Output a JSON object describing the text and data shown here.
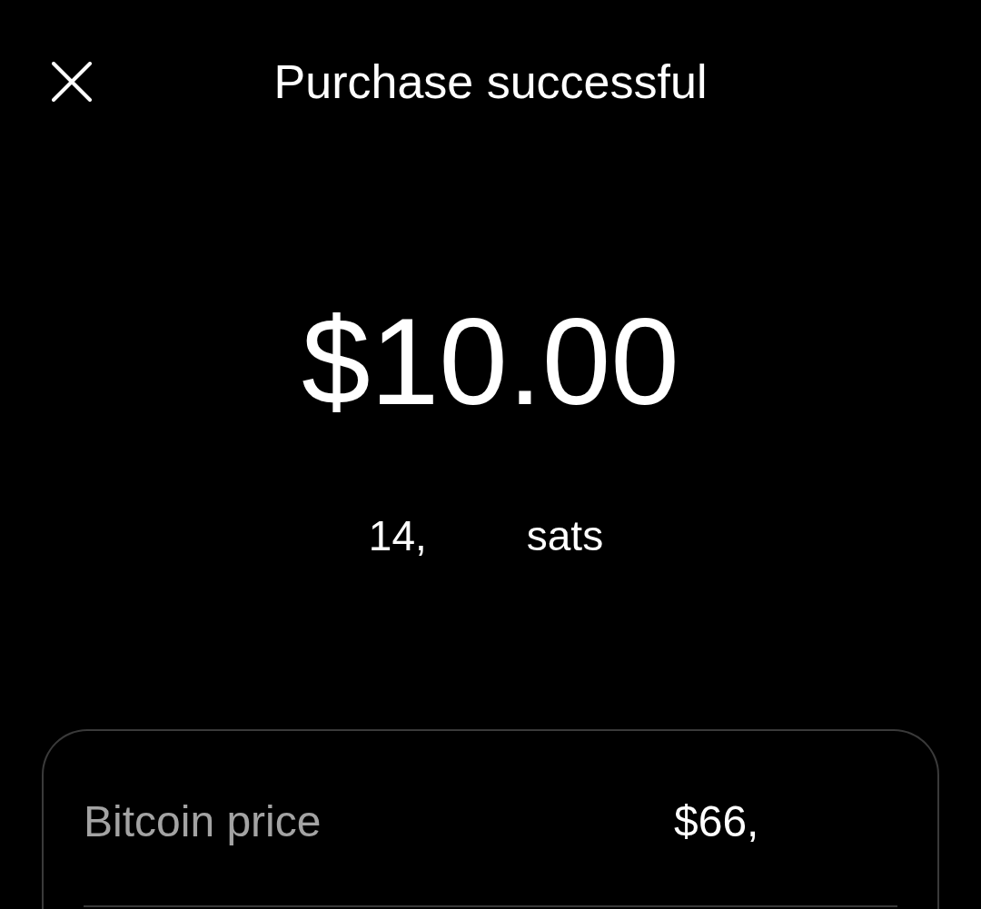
{
  "header": {
    "title": "Purchase successful"
  },
  "amount": "$10.00",
  "sats": {
    "number": "14,",
    "unit": "sats"
  },
  "details": [
    {
      "label": "Bitcoin price",
      "value": "$66,"
    }
  ]
}
